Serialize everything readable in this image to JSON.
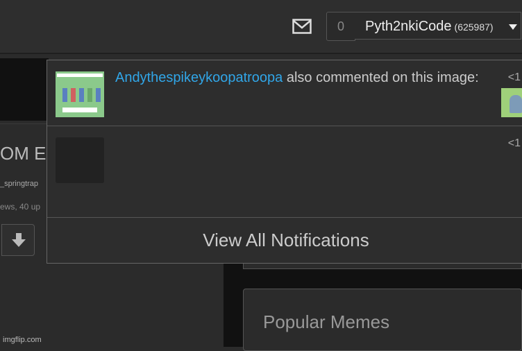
{
  "header": {
    "icons": {
      "mail": "mail-icon",
      "caret": "caret-down-icon"
    },
    "notification_count": "0",
    "username": "Pyth2nkiCode",
    "points": "(625987)"
  },
  "background_page": {
    "title_fragment": "OM E",
    "user_fragment": "_springtrap",
    "stats_fragment": "ews, 40 up",
    "popular_title": "Popular Memes",
    "watermark": "imgflip.com",
    "icons": {
      "downvote": "down-arrow-icon"
    }
  },
  "notifications": {
    "items": [
      {
        "user": "Andythespikeykoopatroopa",
        "text": " also commented on this image:",
        "time": "<1",
        "thumb_icon": "meme-thumbnail"
      },
      {
        "user": "",
        "text": "",
        "time": "<1",
        "thumb_icon": "empty-thumbnail"
      }
    ],
    "view_all_label": "View All Notifications"
  },
  "colors": {
    "link": "#31a6e8",
    "background": "#2b2b2b"
  }
}
